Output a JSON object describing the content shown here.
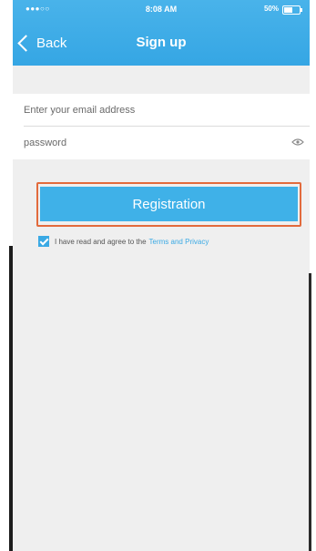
{
  "status_bar": {
    "carrier": "●●●○○",
    "time": "8:08 AM",
    "battery": "50%"
  },
  "nav": {
    "back_label": "Back",
    "title": "Sign up"
  },
  "form": {
    "email_placeholder": "Enter your email address",
    "password_placeholder": "password"
  },
  "actions": {
    "registration_label": "Registration"
  },
  "agreement": {
    "checked": true,
    "text": "I have read and agree to the",
    "link_label": "Terms and Privacy"
  },
  "colors": {
    "header": "#3aa9e4",
    "accent": "#3fb1e8",
    "highlight_outline": "#e26a3c",
    "background": "#efefef"
  },
  "icons": {
    "back": "chevron-left-icon",
    "password_toggle": "eye-icon",
    "checkbox": "checkmark-icon",
    "battery": "battery-icon"
  }
}
